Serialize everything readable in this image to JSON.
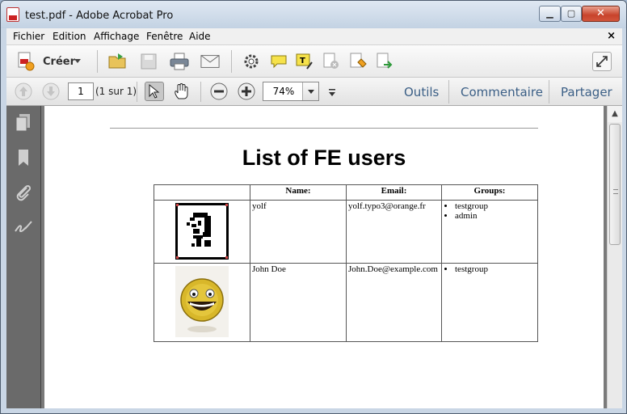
{
  "window": {
    "title": "test.pdf - Adobe Acrobat Pro",
    "minimize": "▁",
    "maximize": "▢",
    "close": "✕"
  },
  "menu": {
    "items": [
      "Fichier",
      "Edition",
      "Affichage",
      "Fenêtre",
      "Aide"
    ],
    "close": "×"
  },
  "toolbar": {
    "create_label": "Créer"
  },
  "nav": {
    "page_number": "1",
    "page_count": "(1 sur 1)",
    "zoom": "74%"
  },
  "panels": {
    "tools": "Outils",
    "comment": "Commentaire",
    "share": "Partager"
  },
  "document": {
    "title": "List of FE users",
    "headers": [
      "",
      "Name:",
      "Email:",
      "Groups:"
    ],
    "rows": [
      {
        "name": "yolf",
        "email": "yolf.typo3@orange.fr",
        "groups": [
          "testgroup",
          "admin"
        ]
      },
      {
        "name": "John Doe",
        "email": "John.Doe@example.com",
        "groups": [
          "testgroup"
        ]
      }
    ]
  }
}
